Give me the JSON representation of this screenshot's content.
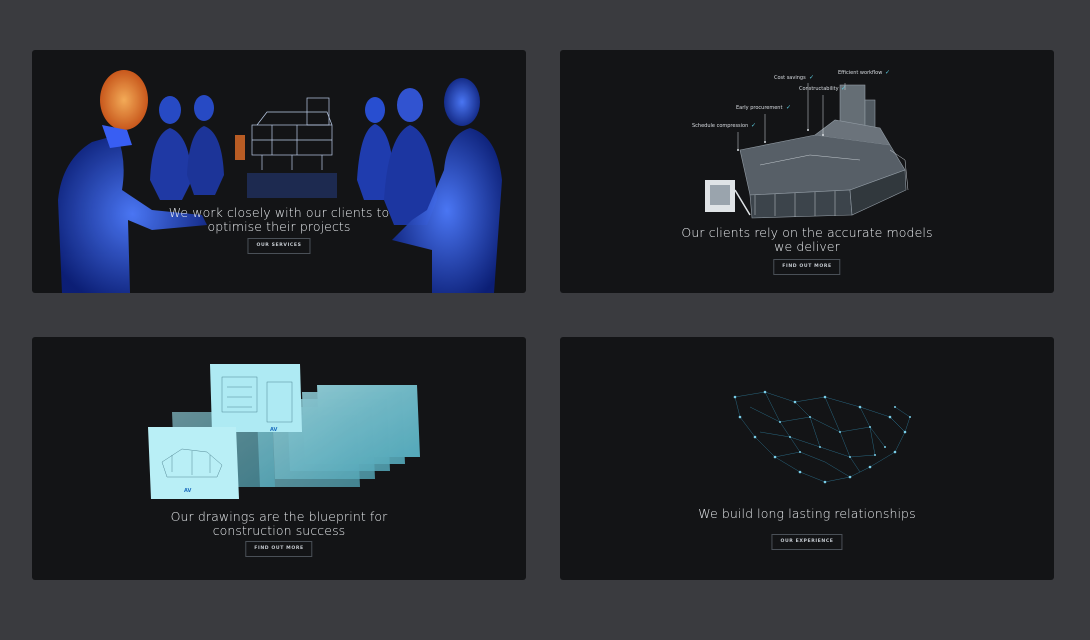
{
  "panels": [
    {
      "caption_lines": [
        "We work closely with our clients to",
        "optimise their projects"
      ],
      "button": "OUR SERVICES"
    },
    {
      "caption_lines": [
        "Our clients rely on the accurate models",
        "we deliver"
      ],
      "button": "FIND OUT MORE",
      "checklist": [
        "Cost savings",
        "Efficient workflow",
        "Constructability",
        "Early procurement",
        "Schedule compression"
      ]
    },
    {
      "caption_lines": [
        "Our drawings are the blueprint for",
        "construction success"
      ],
      "button": "FIND OUT MORE"
    },
    {
      "caption_lines": [
        "We build long lasting relationships"
      ],
      "button": "OUR EXPERIENCE"
    }
  ],
  "colors": {
    "page_bg": "#3a3b3f",
    "card_bg": "#131416",
    "hologram_blue": "#2f5dff",
    "accent_cyan": "#5ed3e8",
    "accent_orange": "#ff8a2a"
  }
}
